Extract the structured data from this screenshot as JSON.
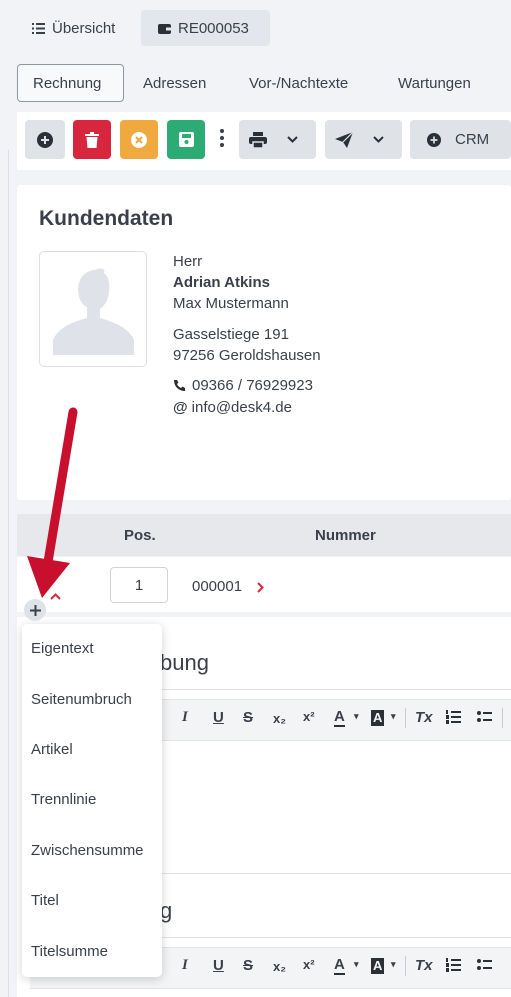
{
  "top_tabs": [
    {
      "label": "Übersicht",
      "icon": "list-icon"
    },
    {
      "label": "RE000053",
      "icon": "wallet-icon"
    }
  ],
  "sub_tabs": [
    "Rechnung",
    "Adressen",
    "Vor-/Nachtexte",
    "Wartungen"
  ],
  "toolbar": {
    "crm_label": "CRM",
    "colors": {
      "add": "#dfe2e7",
      "delete": "#d9263f",
      "cancel": "#f0a93e",
      "save": "#2cab74"
    }
  },
  "customer": {
    "title": "Kundendaten",
    "salutation": "Herr",
    "name": "Adrian Atkins",
    "contact": "Max Mustermann",
    "street": "Gasselstiege 191",
    "city": "97256 Geroldshausen",
    "phone": "09366 / 76929923",
    "email": "info@desk4.de"
  },
  "table": {
    "headers": {
      "pos": "Pos.",
      "nummer": "Nummer"
    },
    "row": {
      "pos": "1",
      "nummer": "000001"
    }
  },
  "detail": {
    "section1_title_partial": "bung",
    "section2_title_partial": "g"
  },
  "menu": {
    "items": [
      "Eigentext",
      "Seitenumbruch",
      "Artikel",
      "Trennlinie",
      "Zwischensumme",
      "Titel",
      "Titelsumme"
    ]
  },
  "editor": {
    "buttons": [
      "I",
      "U",
      "S",
      "x₂",
      "x²",
      "A",
      "A",
      "Tx"
    ]
  }
}
